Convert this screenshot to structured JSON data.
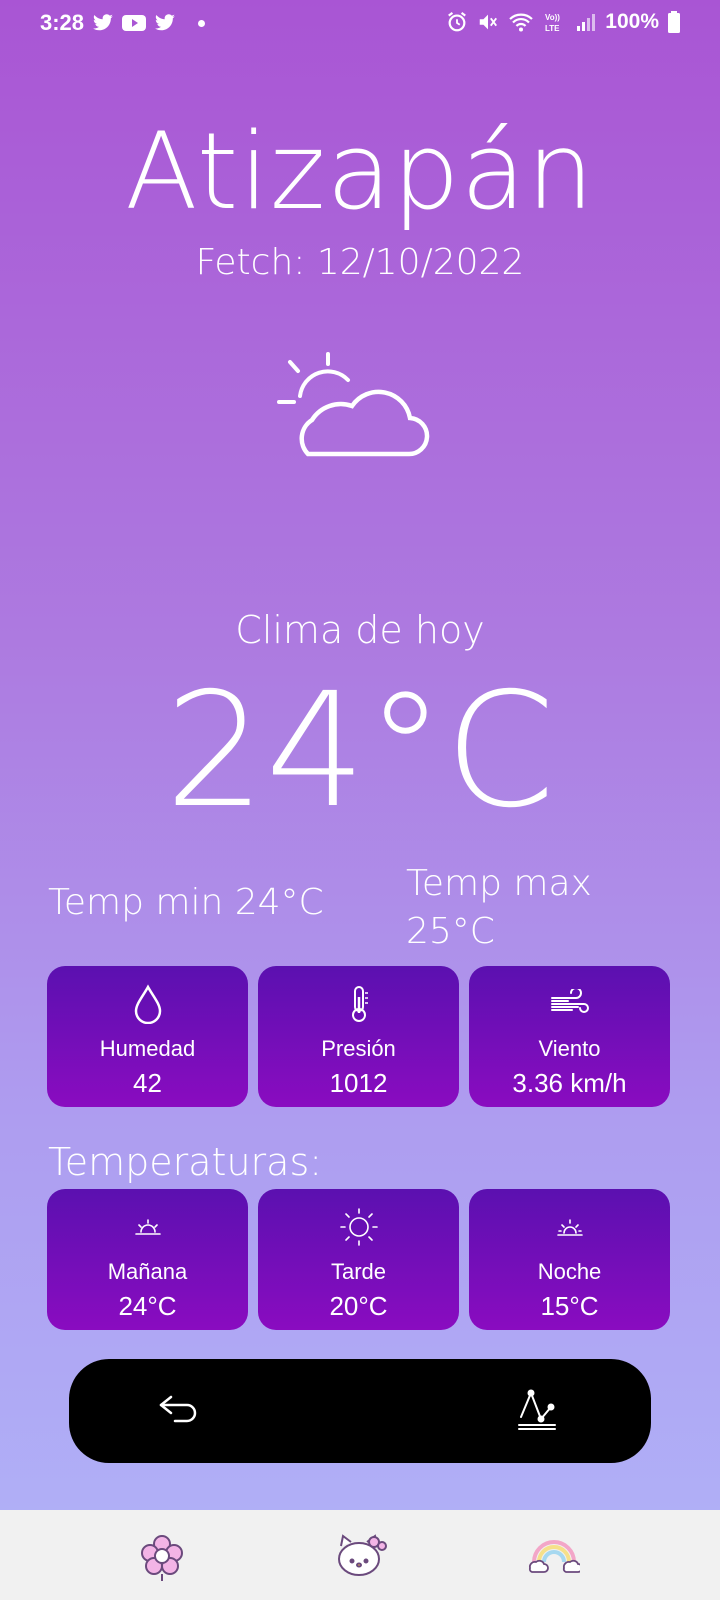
{
  "status_bar": {
    "time": "3:28",
    "battery": "100%",
    "left_icons": [
      "twitter-icon",
      "youtube-icon",
      "twitter-icon",
      "notification-dot"
    ],
    "right_icons": [
      "alarm-icon",
      "mute-icon",
      "wifi-icon",
      "volte-icon",
      "signal-icon",
      "battery-icon"
    ]
  },
  "header": {
    "city": "Atizapán",
    "fetch": "Fetch: 12/10/2022",
    "icon": "partly-cloudy-icon"
  },
  "today": {
    "label": "Clima de hoy",
    "temp": "24°C",
    "min": "Temp min 24°C",
    "max": "Temp max 25°C"
  },
  "conditions": [
    {
      "icon": "water-drop-icon",
      "label": "Humedad",
      "value": "42"
    },
    {
      "icon": "thermometer-icon",
      "label": "Presión",
      "value": "1012"
    },
    {
      "icon": "wind-icon",
      "label": "Viento",
      "value": "3.36 km/h"
    }
  ],
  "temperatures": {
    "title": "Temperaturas:",
    "items": [
      {
        "icon": "sunrise-icon",
        "label": "Mañana",
        "value": "24°C"
      },
      {
        "icon": "sun-icon",
        "label": "Tarde",
        "value": "20°C"
      },
      {
        "icon": "sunset-icon",
        "label": "Noche",
        "value": "15°C"
      }
    ]
  },
  "action_bar": {
    "back_icon": "back-arrow-icon",
    "chart_icon": "line-chart-icon"
  },
  "bottom_nav": [
    "flower-icon",
    "kitty-icon",
    "rainbow-icon"
  ],
  "colors": {
    "bg_top": "#a955d4",
    "bg_bottom": "#b0b3f8",
    "card_top": "#5b10b0",
    "card_bottom": "#8a0cc0",
    "pill": "#000000",
    "nav_bg": "#f1f1f1"
  }
}
